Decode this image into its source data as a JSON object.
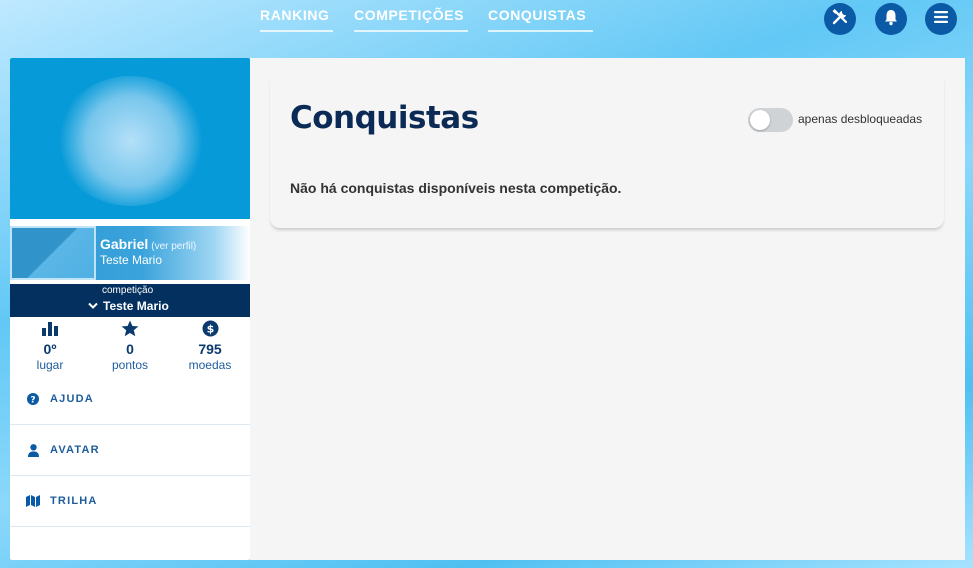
{
  "nav": {
    "tabs": [
      {
        "label": "RANKING"
      },
      {
        "label": "COMPETIÇÕES"
      },
      {
        "label": "CONQUISTAS"
      }
    ],
    "icons": [
      "tools-icon",
      "bell-icon",
      "menu-icon"
    ]
  },
  "profile": {
    "name": "Gabriel",
    "link": "(ver perfil)",
    "subtitle": "Teste Mario"
  },
  "competition": {
    "label": "competição",
    "value": "Teste Mario"
  },
  "stats": [
    {
      "icon": "bar-chart-icon",
      "value": "0º",
      "label": "lugar"
    },
    {
      "icon": "star-icon",
      "value": "0",
      "label": "pontos"
    },
    {
      "icon": "coin-icon",
      "value": "795",
      "label": "moedas"
    }
  ],
  "menu": [
    {
      "icon": "question-icon",
      "label": "AJUDA"
    },
    {
      "icon": "user-icon",
      "label": "AVATAR"
    },
    {
      "icon": "map-icon",
      "label": "TRILHA"
    }
  ],
  "main": {
    "title": "Conquistas",
    "toggle_label": "apenas desbloqueadas",
    "toggle_on": false,
    "empty_message": "Não há conquistas disponíveis nesta competição."
  },
  "colors": {
    "accent": "#0b5aa6",
    "navy": "#03305f",
    "cover": "#069ad8"
  }
}
